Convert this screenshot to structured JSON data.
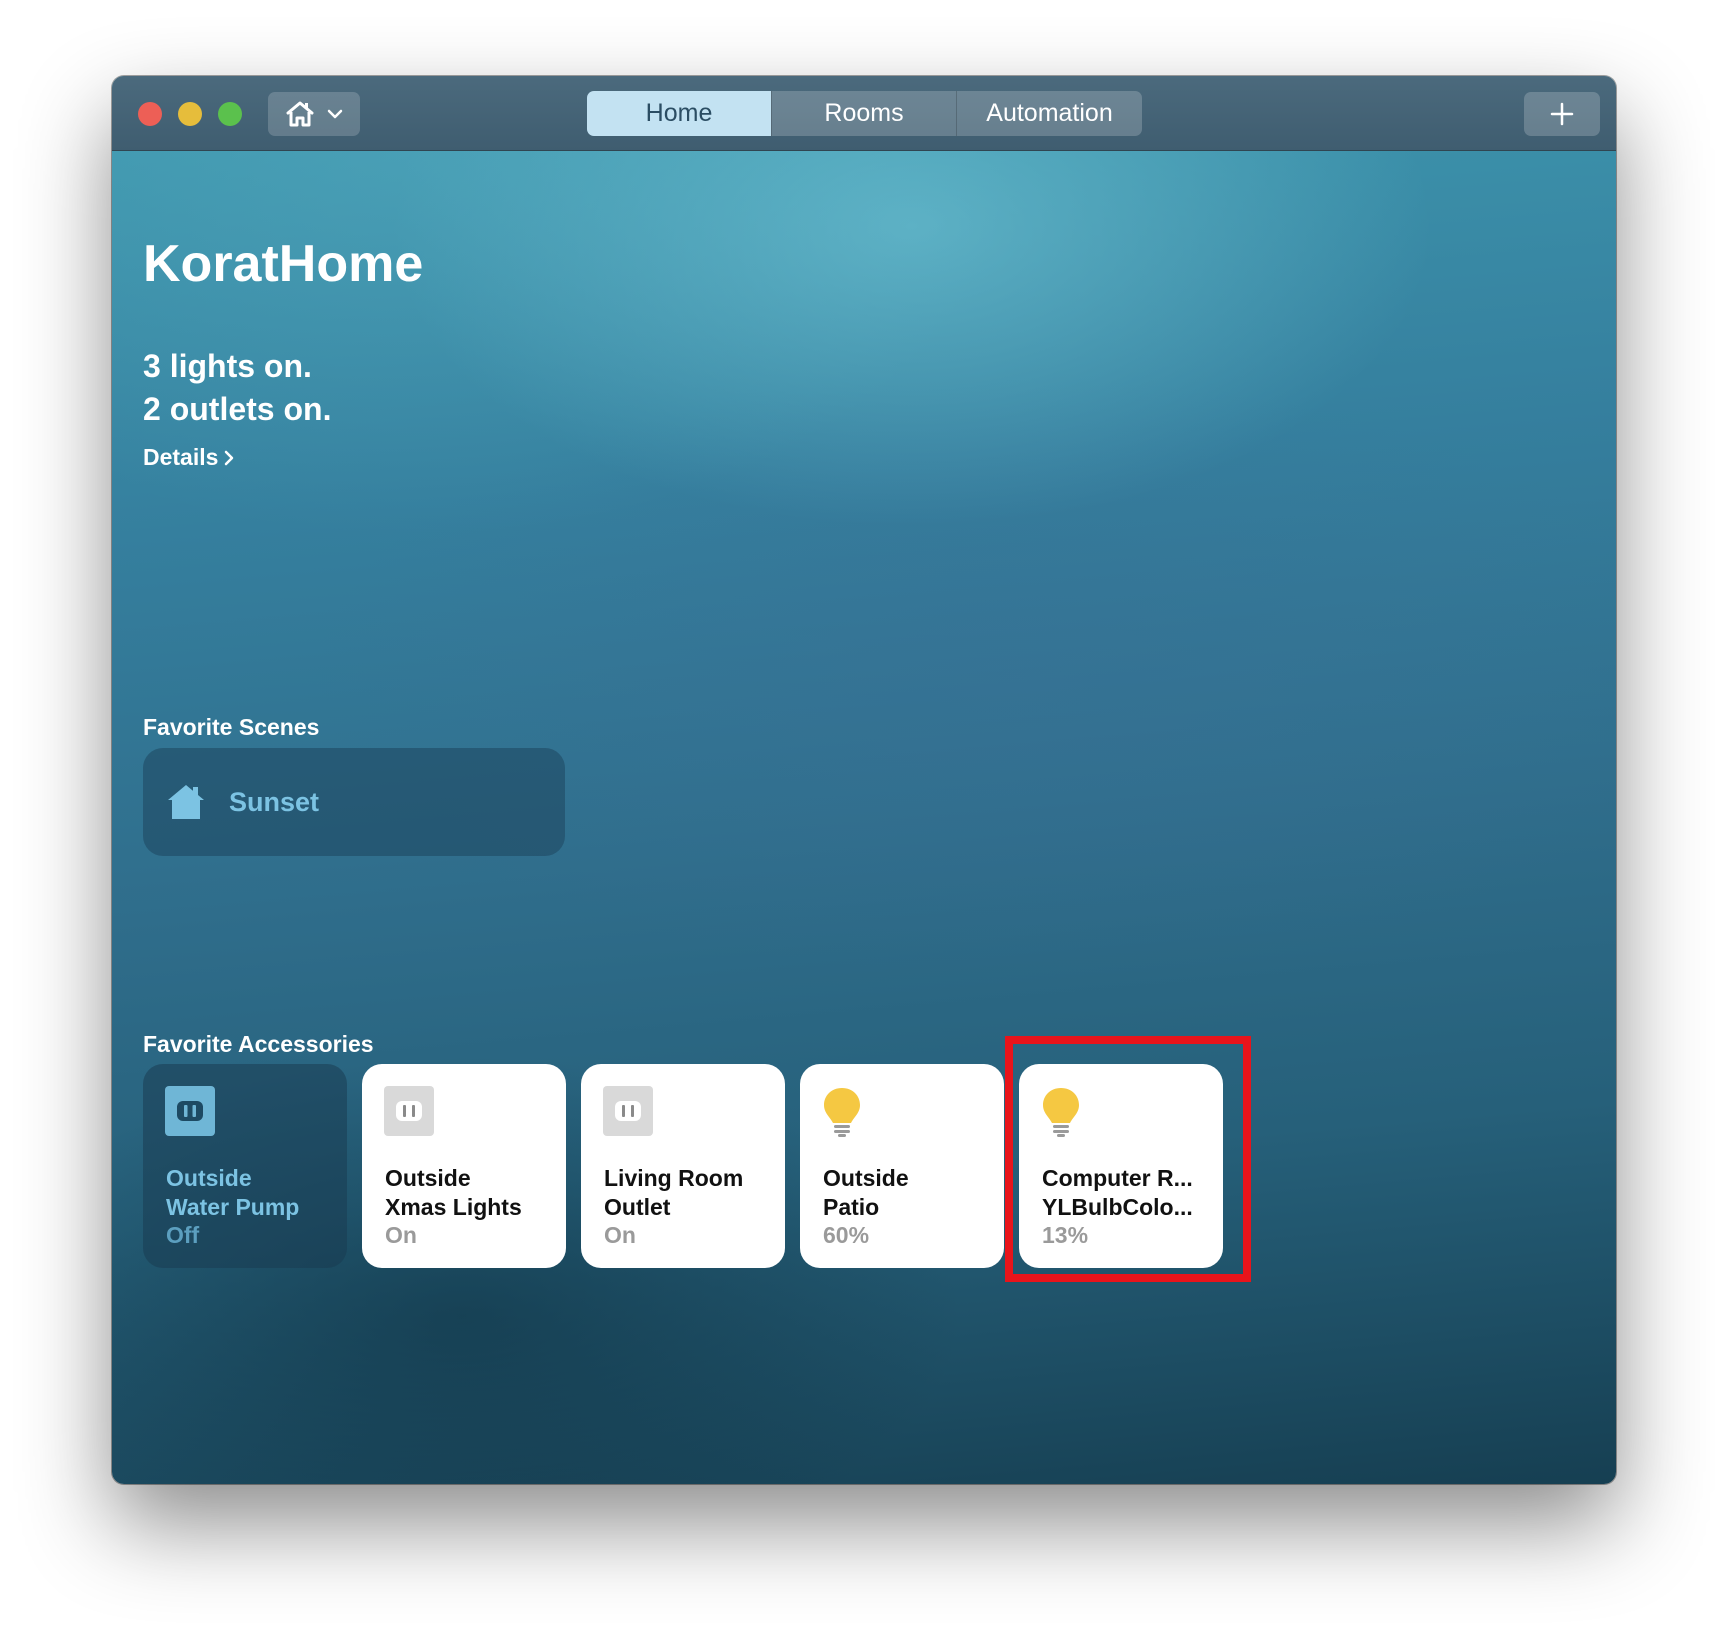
{
  "window": {
    "tabs": [
      {
        "label": "Home",
        "active": true
      },
      {
        "label": "Rooms",
        "active": false
      },
      {
        "label": "Automation",
        "active": false
      }
    ],
    "home_menu_icon": "house-icon",
    "add_button_icon": "plus-icon"
  },
  "home": {
    "title": "KoratHome",
    "status_lines": [
      "3 lights on.",
      "2 outlets on."
    ],
    "details_label": "Details"
  },
  "scenes": {
    "section_title": "Favorite Scenes",
    "items": [
      {
        "label": "Sunset",
        "icon": "scene-house-icon"
      }
    ]
  },
  "accessories": {
    "section_title": "Favorite Accessories",
    "items": [
      {
        "name_line1": "Outside",
        "name_line2": "Water Pump",
        "status": "Off",
        "icon": "outlet-icon",
        "state": "off"
      },
      {
        "name_line1": "Outside",
        "name_line2": "Xmas Lights",
        "status": "On",
        "icon": "outlet-icon",
        "state": "on"
      },
      {
        "name_line1": "Living Room",
        "name_line2": "Outlet",
        "status": "On",
        "icon": "outlet-icon",
        "state": "on"
      },
      {
        "name_line1": "Outside",
        "name_line2": "Patio",
        "status": "60%",
        "icon": "lightbulb-icon",
        "state": "on"
      },
      {
        "name_line1": "Computer R...",
        "name_line2": "YLBulbColo...",
        "status": "13%",
        "icon": "lightbulb-icon",
        "state": "on",
        "highlighted": true
      }
    ]
  },
  "colors": {
    "highlight": "#e8141b",
    "bulb": "#f5c842",
    "scene_text": "#7cc3e3",
    "active_tab": "#c3e2f2"
  }
}
